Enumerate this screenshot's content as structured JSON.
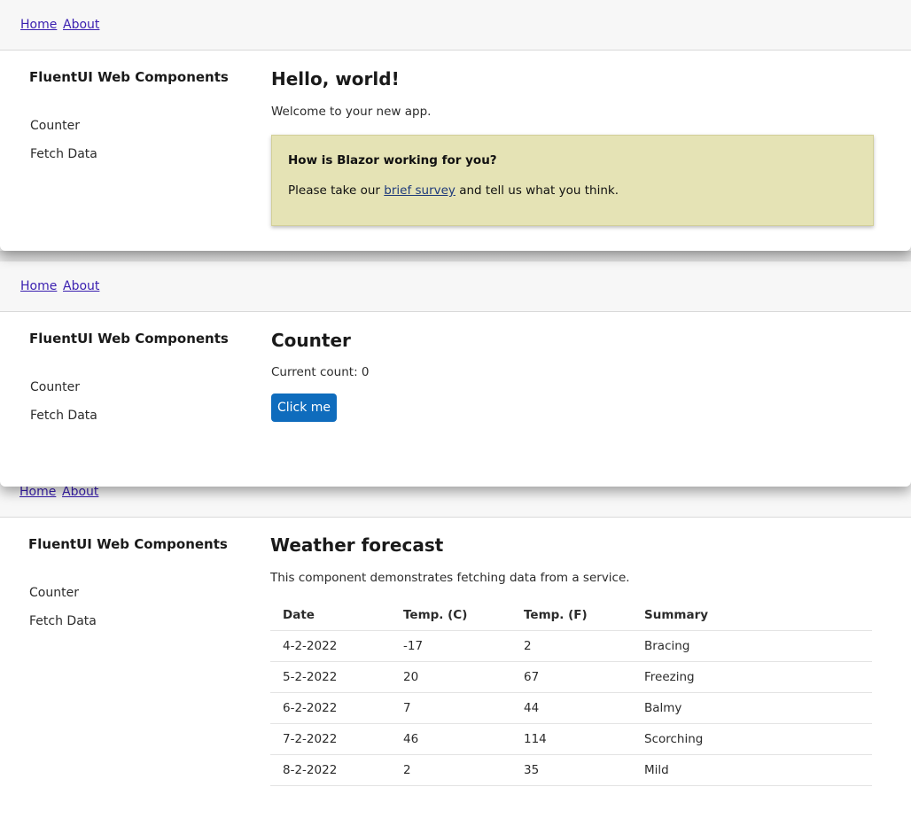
{
  "nav": {
    "home": "Home",
    "about": "About"
  },
  "sidebar": {
    "title": "FluentUI Web Components",
    "items": [
      "Counter",
      "Fetch Data"
    ]
  },
  "home": {
    "title": "Hello, world!",
    "welcome": "Welcome to your new app.",
    "survey": {
      "question": "How is Blazor working for you?",
      "text_before": "Please take our ",
      "link": "brief survey",
      "text_after": " and tell us what you think."
    }
  },
  "counter": {
    "title": "Counter",
    "count_label": "Current count: 0",
    "button": "Click me"
  },
  "weather": {
    "title": "Weather forecast",
    "description": "This component demonstrates fetching data from a service.",
    "headers": [
      "Date",
      "Temp. (C)",
      "Temp. (F)",
      "Summary"
    ],
    "rows": [
      [
        "4-2-2022",
        "-17",
        "2",
        "Bracing"
      ],
      [
        "5-2-2022",
        "20",
        "67",
        "Freezing"
      ],
      [
        "6-2-2022",
        "7",
        "44",
        "Balmy"
      ],
      [
        "7-2-2022",
        "46",
        "114",
        "Scorching"
      ],
      [
        "8-2-2022",
        "2",
        "35",
        "Mild"
      ]
    ]
  }
}
